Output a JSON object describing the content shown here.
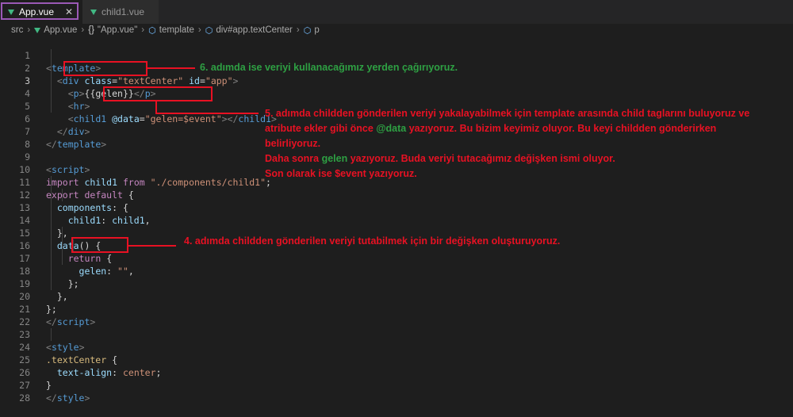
{
  "tabs": [
    {
      "label": "App.vue",
      "close": "✕"
    },
    {
      "label": "child1.vue"
    }
  ],
  "breadcrumb": {
    "src": "src",
    "file": "App.vue",
    "script": "\"App.vue\"",
    "template": "template",
    "div": "div#app.textCenter",
    "p": "p"
  },
  "line_numbers": [
    "1",
    "2",
    "3",
    "4",
    "5",
    "6",
    "7",
    "8",
    "9",
    "10",
    "11",
    "12",
    "13",
    "14",
    "15",
    "16",
    "17",
    "18",
    "19",
    "20",
    "21",
    "22",
    "23",
    "24",
    "25",
    "26",
    "27",
    "28"
  ],
  "code": {
    "l1_tag": "template",
    "l2_tag": "div",
    "l2_attr1": "class",
    "l2_val1": "\"textCenter\"",
    "l2_attr2": "id",
    "l2_val2": "\"app\"",
    "l3_text": "{{gelen}}",
    "l4_tag": "hr",
    "l5_tag": "child1",
    "l5_attr": "@data",
    "l5_val": "\"gelen=$event\"",
    "l9_tag": "script",
    "l10_import": "import",
    "l10_name": "child1",
    "l10_from": "from",
    "l10_path": "\"./components/child1\"",
    "l11_export": "export",
    "l11_default": "default",
    "l12_key": "components",
    "l13_key": "child1",
    "l13_val": "child1",
    "l15_fn": "data",
    "l16_return": "return",
    "l17_key": "gelen",
    "l17_val": "\"\"",
    "l22_tag": "script",
    "l24_tag": "style",
    "l25_sel": ".textCenter",
    "l26_prop": "text-align",
    "l26_val": "center",
    "l28_tag": "style"
  },
  "annotations": {
    "step6": "6. adımda ise veriyi kullanacağımız yerden çağırıyoruz.",
    "step5_a": "5. adımda childden gönderilen veriyi yakalayabilmek için template arasında child taglarını buluyoruz ve",
    "step5_b_pre": "atribute ekler gibi önce ",
    "step5_b_hl": "@data",
    "step5_b_post": " yazıyoruz. Bu bizim keyimiz oluyor. Bu keyi childden gönderirken",
    "step5_c": "belirliyoruz.",
    "step5_d_pre": "Daha sonra ",
    "step5_d_hl": "gelen",
    "step5_d_post": " yazıyoruz. Buda veriyi tutacağımız değişken ismi oluyor.",
    "step5_e": "Son olarak ise $event yazıyoruz.",
    "step4": "4. adımda childden gönderilen veriyi tutabilmek için bir değişken oluşturuyoruz."
  },
  "colors": {
    "highlight_red": "#e81123",
    "note_green": "#2ea043",
    "tab_highlight": "#9b59b6",
    "vue_green": "#41b883"
  }
}
